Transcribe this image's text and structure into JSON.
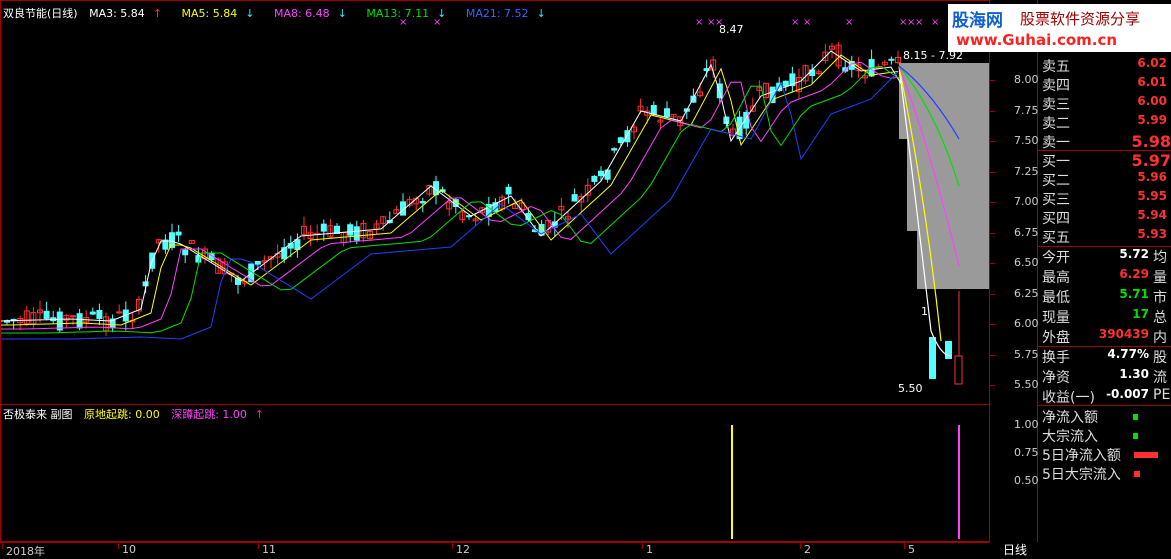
{
  "legend": {
    "title": "双良节能(日线)",
    "ma3": "MA3: 5.84",
    "ma5": "MA5: 5.84",
    "ma8": "MA8: 6.48",
    "ma13": "MA13: 7.11",
    "ma21": "MA21: 7.52",
    "up_arrow": "↑",
    "down_arrow": "↓"
  },
  "annotations": {
    "high": "8.47",
    "range": "8.15 - 7.92",
    "low": "5.50",
    "marker": "1"
  },
  "price_ticks": [
    "8.00",
    "7.75",
    "7.50",
    "7.25",
    "7.00",
    "6.75",
    "6.50",
    "6.25",
    "6.00",
    "5.75",
    "5.50"
  ],
  "sub_legend": {
    "title": "否极泰来 副图",
    "a": "原地起跳: 0.00",
    "b": "深蹲起跳: 1.00",
    "arrow": "↑"
  },
  "sub_ticks": [
    "1.00",
    "0.75",
    "0.50"
  ],
  "date_ticks": [
    "2018年",
    "10",
    "11",
    "12",
    "1",
    "2",
    "5"
  ],
  "period_label": "日线",
  "logo": {
    "line1": "股海网",
    "line2": "股票软件资源分享",
    "line3": "www.Guhai.com.cn"
  },
  "quote": {
    "sell": [
      {
        "label": "卖五",
        "price": "6.02"
      },
      {
        "label": "卖四",
        "price": "6.01"
      },
      {
        "label": "卖三",
        "price": "6.00"
      },
      {
        "label": "卖二",
        "price": "5.99"
      },
      {
        "label": "卖一",
        "price": "5.98"
      }
    ],
    "buy": [
      {
        "label": "买一",
        "price": "5.97"
      },
      {
        "label": "买二",
        "price": "5.96"
      },
      {
        "label": "买三",
        "price": "5.95"
      },
      {
        "label": "买四",
        "price": "5.94"
      },
      {
        "label": "买五",
        "price": "5.93"
      }
    ],
    "stats": [
      {
        "label": "今开",
        "value": "5.72",
        "extra": "均"
      },
      {
        "label": "最高",
        "value": "6.29",
        "extra": "量"
      },
      {
        "label": "最低",
        "value": "5.71",
        "extra": "市"
      },
      {
        "label": "现量",
        "value": "17",
        "extra": "总"
      },
      {
        "label": "外盘",
        "value": "390439",
        "extra": "内"
      }
    ],
    "stats2": [
      {
        "label": "换手",
        "value": "4.77%",
        "extra": "股"
      },
      {
        "label": "净资",
        "value": "1.30",
        "extra": "流"
      },
      {
        "label": "收益(一)",
        "value": "-0.007",
        "extra": "PE"
      }
    ],
    "flows": [
      {
        "label": "净流入额"
      },
      {
        "label": "大宗流入"
      },
      {
        "label": "5日净流入额"
      },
      {
        "label": "5日大宗流入"
      }
    ]
  },
  "colors": {
    "up": "#ff3030",
    "down": "#54ffff",
    "ma3": "#ffffff",
    "ma5": "#ffff00",
    "ma8": "#ff40ff",
    "ma13": "#00e000",
    "ma21": "#2040ff",
    "axis": "#a00000"
  }
}
